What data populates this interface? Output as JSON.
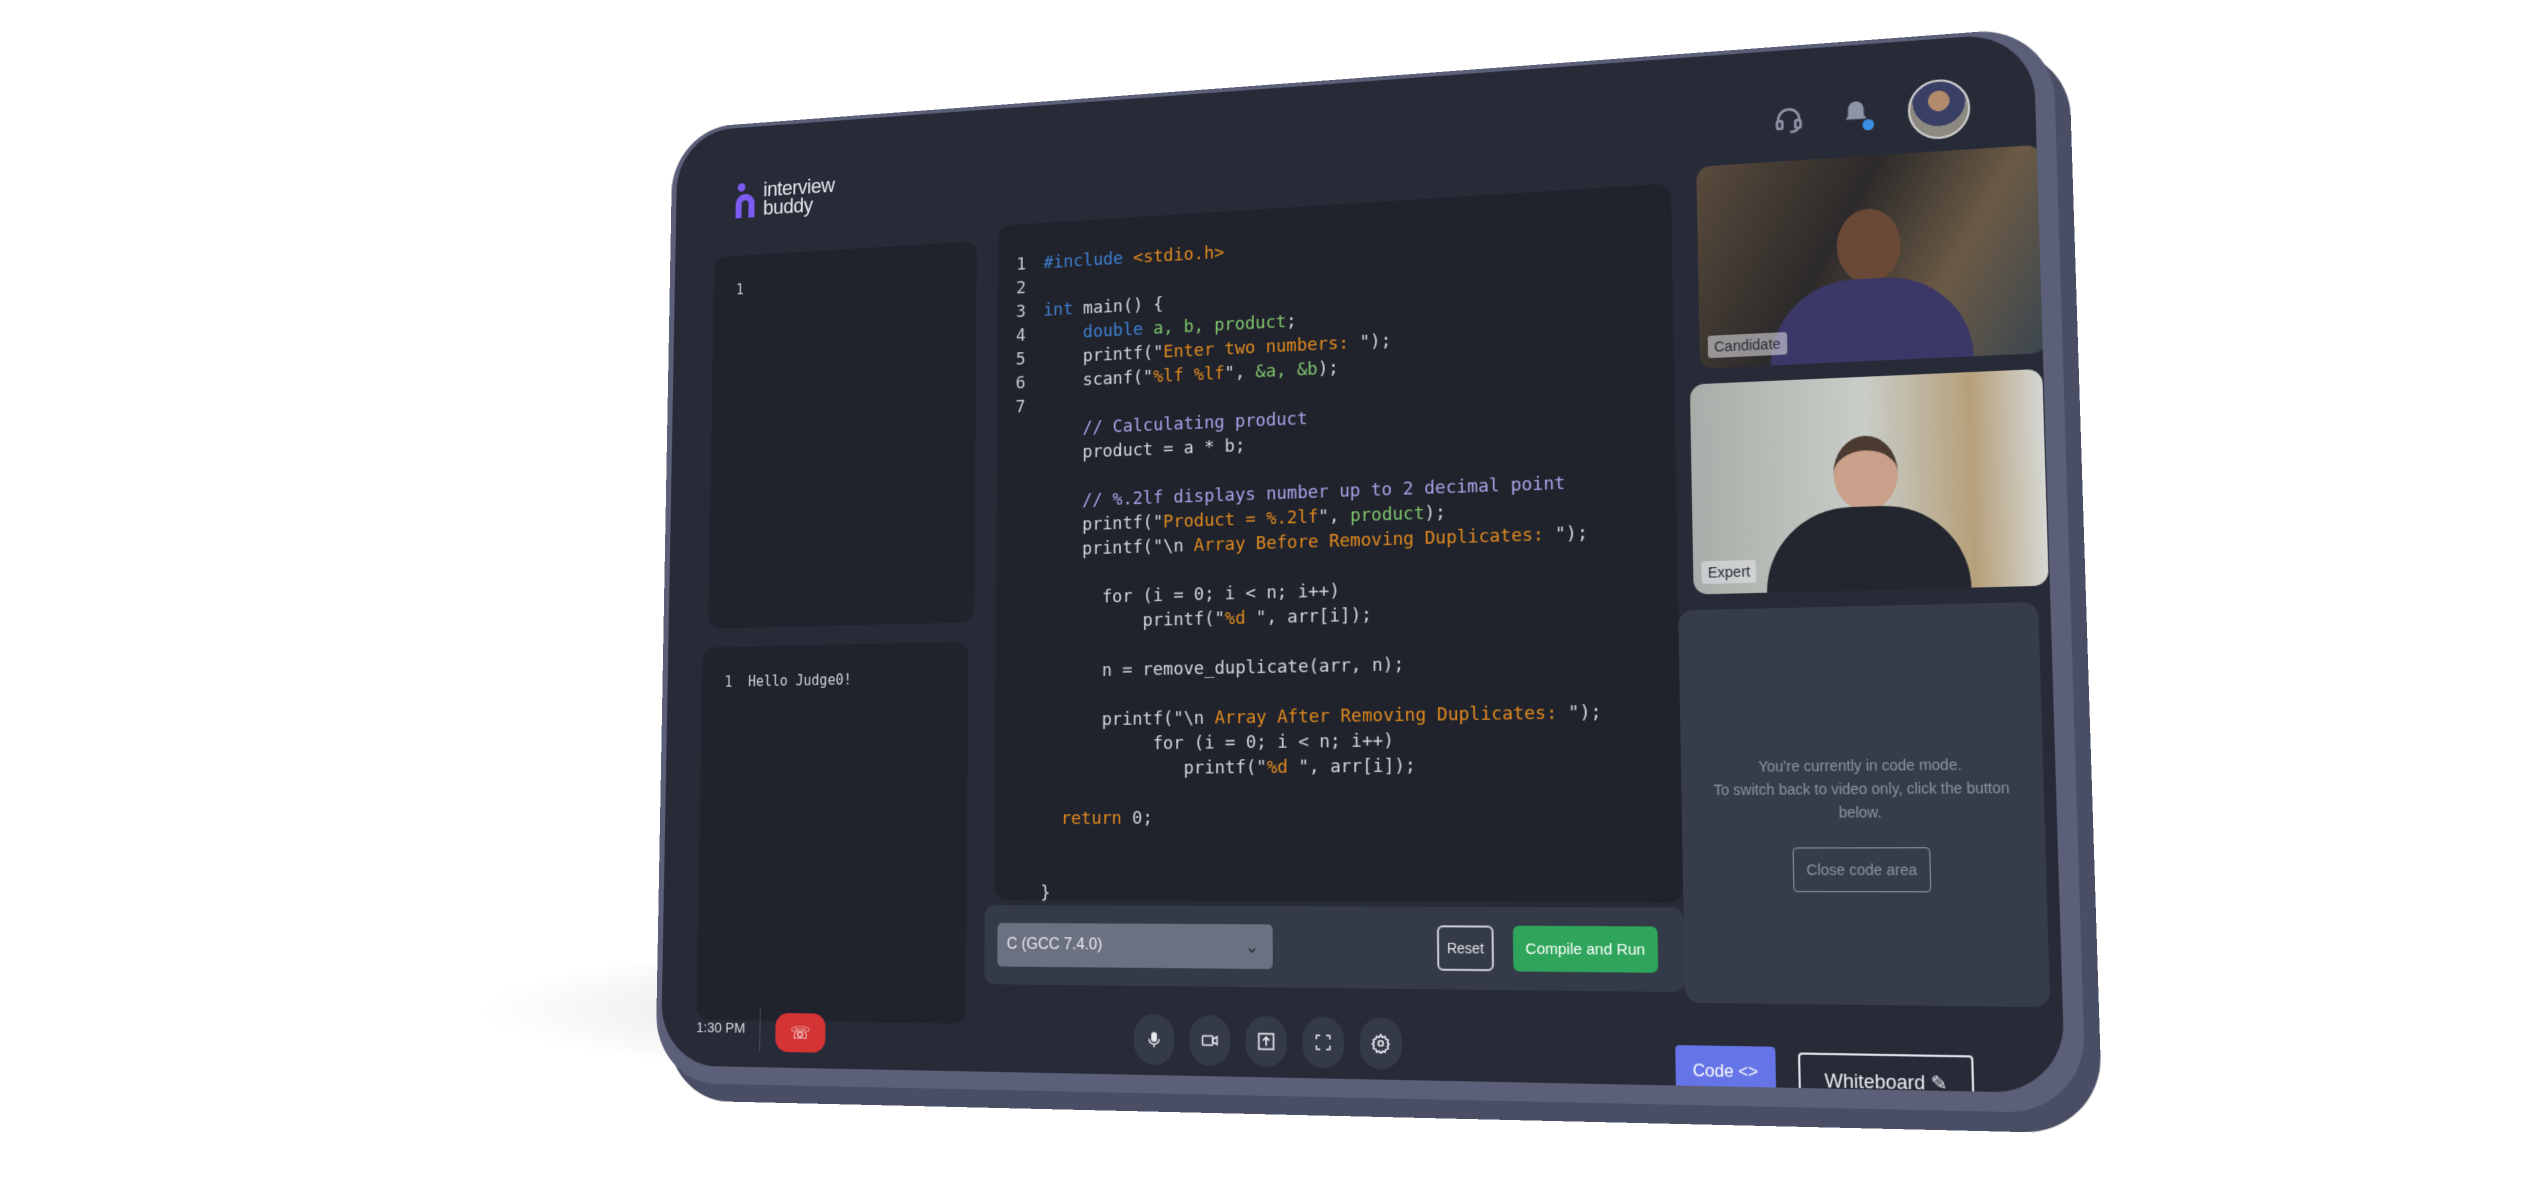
{
  "brand": {
    "line1": "interview",
    "line2": "buddy",
    "accent": "#7c5cf0"
  },
  "header": {
    "icons": [
      "headset-icon",
      "bell-icon",
      "avatar"
    ]
  },
  "input_panel": {
    "line_number": "1",
    "content": ""
  },
  "output_panel": {
    "line_number": "1",
    "content": "Hello Judge0!"
  },
  "editor": {
    "line_numbers": [
      "1",
      "2",
      "3",
      "4",
      "5",
      "6",
      "7"
    ],
    "lines": [
      [
        {
          "t": "#include ",
          "k": "k"
        },
        {
          "t": "<stdio.h>",
          "k": "s"
        }
      ],
      [],
      [
        {
          "t": "int ",
          "k": "k"
        },
        {
          "t": "main() {",
          "k": "p"
        }
      ],
      [
        {
          "t": "    double ",
          "k": "k"
        },
        {
          "t": "a, b, product",
          "k": "v"
        },
        {
          "t": ";",
          "k": "p"
        }
      ],
      [
        {
          "t": "    printf(\"",
          "k": "p"
        },
        {
          "t": "Enter two numbers: ",
          "k": "s"
        },
        {
          "t": "\");",
          "k": "p"
        }
      ],
      [
        {
          "t": "    scanf(\"",
          "k": "p"
        },
        {
          "t": "%lf %lf",
          "k": "s"
        },
        {
          "t": "\", ",
          "k": "p"
        },
        {
          "t": "&a, &b",
          "k": "v"
        },
        {
          "t": ");",
          "k": "p"
        }
      ],
      [],
      [
        {
          "t": "    // Calculating product",
          "k": "c"
        }
      ],
      [
        {
          "t": "    product = a * b;",
          "k": "p"
        }
      ],
      [],
      [
        {
          "t": "    // %.2lf displays number up to 2 decimal point",
          "k": "c"
        }
      ],
      [
        {
          "t": "    printf(\"",
          "k": "p"
        },
        {
          "t": "Product = %.2lf",
          "k": "s"
        },
        {
          "t": "\", ",
          "k": "p"
        },
        {
          "t": "product",
          "k": "v"
        },
        {
          "t": ");",
          "k": "p"
        }
      ],
      [
        {
          "t": "    printf(\"\\n ",
          "k": "p"
        },
        {
          "t": "Array Before Removing Duplicates: ",
          "k": "s"
        },
        {
          "t": "\");",
          "k": "p"
        }
      ],
      [],
      [
        {
          "t": "      for (i = 0; i < n; i++)",
          "k": "p"
        }
      ],
      [
        {
          "t": "          printf(\"",
          "k": "p"
        },
        {
          "t": "%d ",
          "k": "s"
        },
        {
          "t": "\", arr[i]);",
          "k": "p"
        }
      ],
      [],
      [
        {
          "t": "      n = remove_duplicate(arr, n);",
          "k": "p"
        }
      ],
      [],
      [
        {
          "t": "      printf(\"\\n ",
          "k": "p"
        },
        {
          "t": "Array After Removing Duplicates: ",
          "k": "s"
        },
        {
          "t": "\");",
          "k": "p"
        }
      ],
      [
        {
          "t": "           for (i = 0; i < n; i++)",
          "k": "p"
        }
      ],
      [
        {
          "t": "              printf(\"",
          "k": "p"
        },
        {
          "t": "%d ",
          "k": "s"
        },
        {
          "t": "\", arr[i]);",
          "k": "p"
        }
      ],
      [],
      [
        {
          "t": "  return ",
          "k": "r"
        },
        {
          "t": "0;",
          "k": "p"
        }
      ],
      [],
      [],
      [
        {
          "t": "}",
          "k": "p"
        }
      ]
    ]
  },
  "toolbar": {
    "language": "C (GCC 7.4.0)",
    "reset_label": "Reset",
    "run_label": "Compile and Run",
    "run_color": "#2ea55a"
  },
  "videos": {
    "candidate_label": "Candidate",
    "expert_label": "Expert"
  },
  "info": {
    "line1": "You're currently in code mode.",
    "line2": "To switch back to video only, click the button below.",
    "close_label": "Close code area"
  },
  "footer": {
    "time": "1:30 PM",
    "end_call_color": "#d43434",
    "controls": [
      "microphone-icon",
      "camera-icon",
      "share-screen-icon",
      "fullscreen-icon",
      "settings-icon"
    ],
    "code_label": "Code",
    "code_color": "#6574e6",
    "whiteboard_label": "Whiteboard"
  }
}
